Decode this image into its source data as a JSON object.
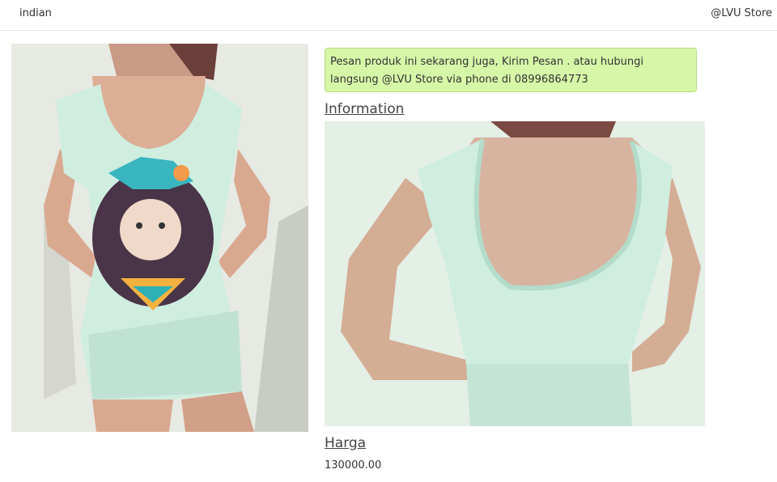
{
  "nav": {
    "brand": "indian",
    "store": "@LVU Store"
  },
  "alert": {
    "text_before": "Pesan produk ini sekarang juga, ",
    "order_link": "Kirim Pesan",
    "text_after": " . atau hubungi langsung @LVU Store via phone di 08996864773"
  },
  "sections": {
    "information_title": "Information",
    "price_title": "Harga",
    "price_value": "130000.00"
  },
  "images": {
    "front": "dress-front-photo",
    "back": "dress-back-photo"
  },
  "colors": {
    "alert_bg": "#d6f7a8",
    "dress": "#cfeee0",
    "wall": "#e6e8e2"
  }
}
